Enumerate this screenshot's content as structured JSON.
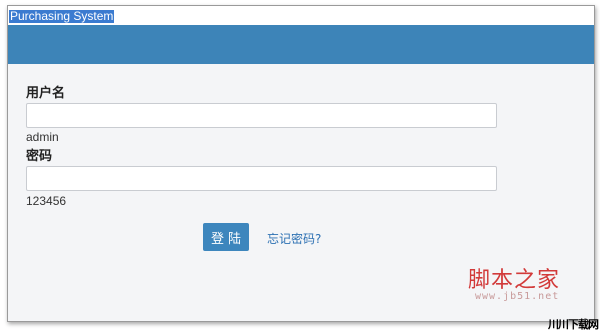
{
  "header": {
    "app_title": "Purchasing System"
  },
  "form": {
    "username_label": "用户名",
    "username_hint": "admin",
    "password_label": "密码",
    "password_hint": "123456",
    "login_button": "登陆",
    "forgot_link": "忘记密码?"
  },
  "watermark": {
    "title": "脚本之家",
    "url": "www.jb51.net",
    "corner": "川川下载网"
  },
  "colors": {
    "header_band": "#3d84b8",
    "button": "#3d86bd",
    "link": "#2c70b3"
  }
}
